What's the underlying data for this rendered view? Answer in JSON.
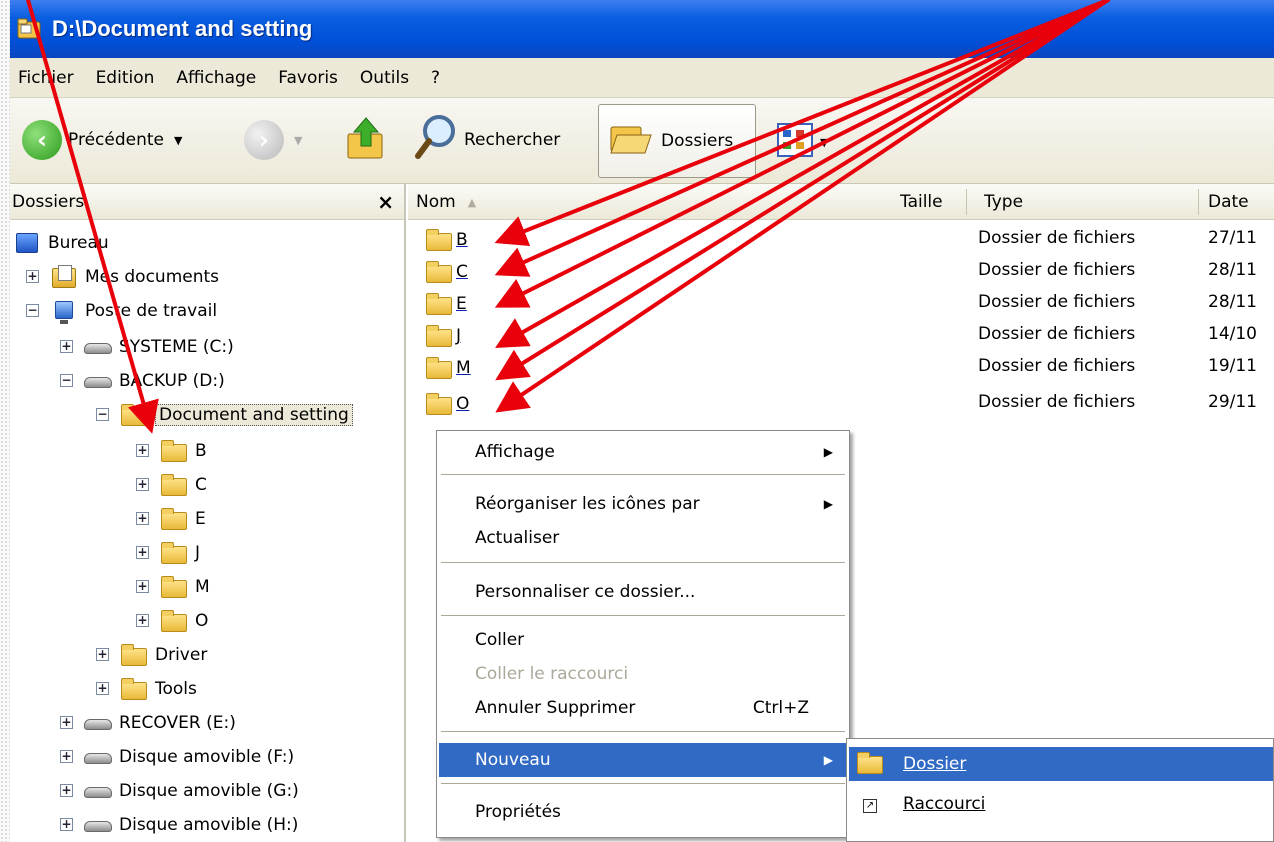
{
  "window": {
    "title": "D:\\Document and setting"
  },
  "menubar": {
    "items": [
      "Fichier",
      "Edition",
      "Affichage",
      "Favoris",
      "Outils",
      "?"
    ]
  },
  "toolbar": {
    "back_label": "Précédente",
    "search_label": "Rechercher",
    "folders_label": "Dossiers"
  },
  "folder_pane": {
    "title": "Dossiers",
    "close_glyph": "×",
    "tree": [
      {
        "label": "Bureau",
        "icon": "desktop-icon"
      },
      {
        "label": "Mes documents",
        "icon": "my-documents-icon",
        "expander": "+"
      },
      {
        "label": "Poste de travail",
        "icon": "my-computer-icon",
        "expander": "−"
      },
      {
        "label": "SYSTEME (C:)",
        "icon": "drive-icon",
        "expander": "+"
      },
      {
        "label": "BACKUP (D:)",
        "icon": "drive-icon",
        "expander": "−"
      },
      {
        "label": "Document and setting",
        "icon": "open-folder-icon",
        "expander": "−"
      },
      {
        "label": "B",
        "icon": "folder-icon",
        "expander": "+"
      },
      {
        "label": "C",
        "icon": "folder-icon",
        "expander": "+"
      },
      {
        "label": "E",
        "icon": "folder-icon",
        "expander": "+"
      },
      {
        "label": "J",
        "icon": "folder-icon",
        "expander": "+"
      },
      {
        "label": "M",
        "icon": "folder-icon",
        "expander": "+"
      },
      {
        "label": "O",
        "icon": "folder-icon",
        "expander": "+"
      },
      {
        "label": "Driver",
        "icon": "folder-icon",
        "expander": "+"
      },
      {
        "label": "Tools",
        "icon": "folder-icon",
        "expander": "+"
      },
      {
        "label": "RECOVER (E:)",
        "icon": "drive-icon",
        "expander": "+"
      },
      {
        "label": "Disque amovible (F:)",
        "icon": "removable-drive-icon",
        "expander": "+"
      },
      {
        "label": "Disque amovible (G:)",
        "icon": "removable-drive-icon",
        "expander": "+"
      },
      {
        "label": "Disque amovible (H:)",
        "icon": "removable-drive-icon",
        "expander": "+"
      }
    ]
  },
  "list_pane": {
    "columns": [
      "Nom",
      "Taille",
      "Type",
      "Date"
    ],
    "sort_glyph": "▲",
    "rows": [
      {
        "name": "B",
        "type": "Dossier de fichiers",
        "date": "27/11"
      },
      {
        "name": "C",
        "type": "Dossier de fichiers",
        "date": "28/11"
      },
      {
        "name": "E",
        "type": "Dossier de fichiers",
        "date": "28/11"
      },
      {
        "name": "J",
        "type": "Dossier de fichiers",
        "date": "14/10"
      },
      {
        "name": "M",
        "type": "Dossier de fichiers",
        "date": "19/11"
      },
      {
        "name": "O",
        "type": "Dossier de fichiers",
        "date": "29/11"
      }
    ]
  },
  "context_menu": {
    "items": {
      "view": "Affichage",
      "arrange": "Réorganiser les icônes par",
      "refresh": "Actualiser",
      "customize": "Personnaliser ce dossier...",
      "paste": "Coller",
      "paste_shortcut": "Coller le raccourci",
      "undo_delete": "Annuler Supprimer",
      "undo_shortcut": "Ctrl+Z",
      "new": "Nouveau",
      "properties": "Propriétés"
    }
  },
  "submenu": {
    "folder": "Dossier",
    "shortcut": "Raccourci"
  },
  "colors": {
    "titlebar": "#0a5ee0",
    "menu_highlight": "#316ac5",
    "annotation_arrow": "#e8000b",
    "chrome": "#ece9d8"
  }
}
